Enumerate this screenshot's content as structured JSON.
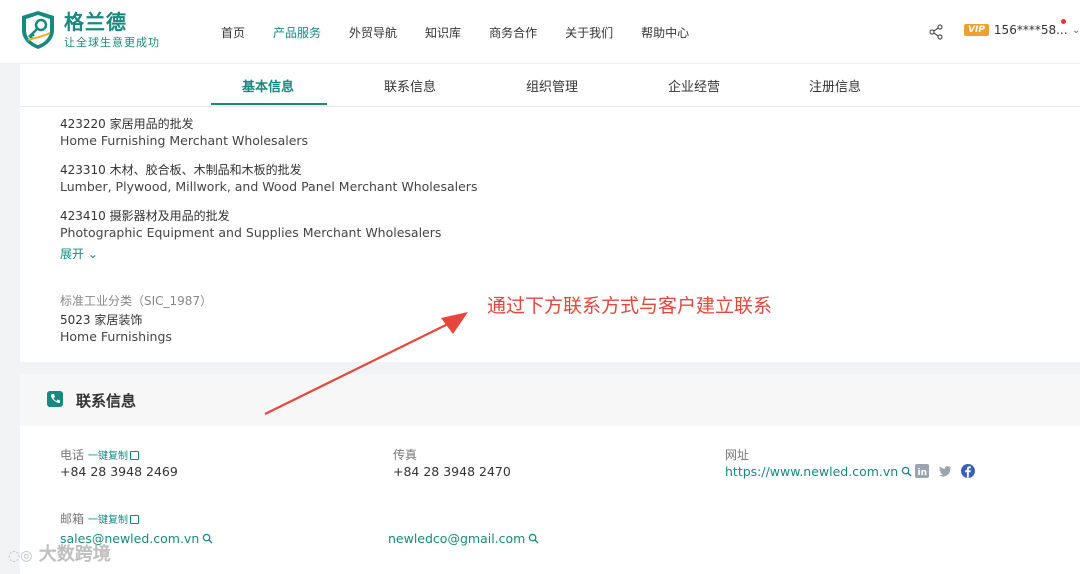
{
  "header": {
    "logo_name": "格兰德",
    "logo_slogan": "让全球生意更成功",
    "nav": [
      "首页",
      "产品服务",
      "外贸导航",
      "知识库",
      "商务合作",
      "关于我们",
      "帮助中心"
    ],
    "nav_active": "产品服务",
    "vip_badge": "VIP",
    "user_phone": "156****58..."
  },
  "tabs": [
    "基本信息",
    "联系信息",
    "组织管理",
    "企业经营",
    "注册信息"
  ],
  "industry": {
    "items": [
      {
        "code_name": "423220  家居用品的批发",
        "english": "Home Furnishing Merchant Wholesalers"
      },
      {
        "code_name": "423310  木材、胶合板、木制品和木板的批发",
        "english": "Lumber, Plywood, Millwork, and Wood Panel Merchant Wholesalers"
      },
      {
        "code_name": "423410  摄影器材及用品的批发",
        "english": "Photographic Equipment and Supplies Merchant Wholesalers"
      }
    ],
    "expand_label": "展开",
    "sic_label": "标准工业分类（SIC_1987）",
    "sic_code_name": "5023  家居装饰",
    "sic_english": "Home Furnishings"
  },
  "annotation": "通过下方联系方式与客户建立联系",
  "contact": {
    "title": "联系信息",
    "copy_label": "一键复制",
    "phone_label": "电话",
    "phone_value": "+84 28 3948 2469",
    "fax_label": "传真",
    "fax_value": "+84 28 3948 2470",
    "website_label": "网址",
    "website_value": "https://www.newled.com.vn",
    "email_label": "邮箱",
    "email_1": "sales@newled.com.vn",
    "email_2": "newledco@gmail.com"
  },
  "watermark": "大数跨境",
  "colors": {
    "brand": "#168a7e",
    "annotation": "#e8453c",
    "vip": "#f0a030"
  }
}
